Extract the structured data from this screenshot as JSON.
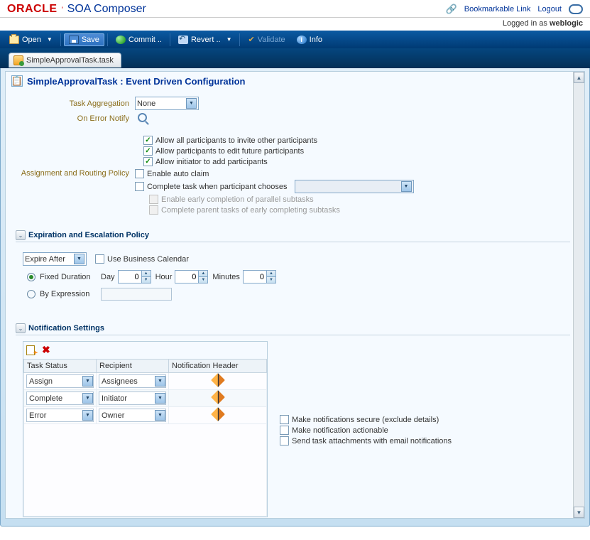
{
  "header": {
    "logo_text": "ORACLE",
    "app_name": "SOA Composer",
    "bookmark_link": "Bookmarkable Link",
    "logout": "Logout",
    "logged_prefix": "Logged in as ",
    "logged_user": "weblogic"
  },
  "toolbar": {
    "open": "Open",
    "save": "Save",
    "commit": "Commit ..",
    "revert": "Revert ..",
    "validate": "Validate",
    "info": "Info"
  },
  "tab": {
    "label": "SimpleApprovalTask.task"
  },
  "panel": {
    "title": "SimpleApprovalTask : Event Driven Configuration"
  },
  "top_form": {
    "task_agg_label": "Task Aggregation",
    "task_agg_value": "None",
    "on_error_label": "On Error Notify",
    "routing_label": "Assignment and Routing Policy",
    "chk1": "Allow all participants to invite other participants",
    "chk2": "Allow participants to edit future participants",
    "chk3": "Allow initiator to add participants",
    "chk4": "Enable auto claim",
    "chk5": "Complete task when participant chooses",
    "chk6": "Enable early completion of parallel subtasks",
    "chk7": "Complete parent tasks of early completing subtasks"
  },
  "expiration": {
    "section_title": "Expiration and Escalation Policy",
    "mode": "Expire After",
    "use_bus_cal": "Use Business Calendar",
    "fixed_label": "Fixed Duration",
    "day_lbl": "Day",
    "day_val": "0",
    "hour_lbl": "Hour",
    "hour_val": "0",
    "min_lbl": "Minutes",
    "min_val": "0",
    "by_expr_label": "By Expression"
  },
  "notif": {
    "section_title": "Notification Settings",
    "col1": "Task Status",
    "col2": "Recipient",
    "col3": "Notification Header",
    "rows": [
      {
        "status": "Assign",
        "recipient": "Assignees"
      },
      {
        "status": "Complete",
        "recipient": "Initiator"
      },
      {
        "status": "Error",
        "recipient": "Owner"
      }
    ],
    "opt1": "Make notifications secure (exclude details)",
    "opt2": "Make notification actionable",
    "opt3": "Send task attachments with email notifications"
  }
}
